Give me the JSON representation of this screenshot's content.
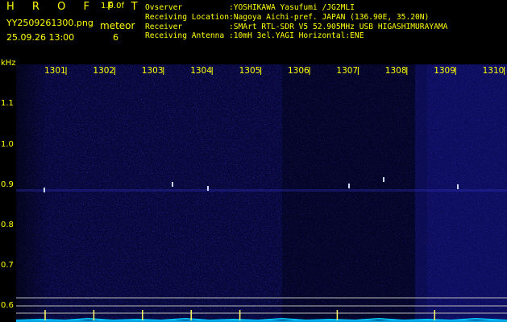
{
  "header": {
    "app_name": "H R O F F T",
    "version": "1.0.0f",
    "filename": "YY2509261300.png",
    "datetime": "25.09.26 13:00",
    "meteor_label": "meteor",
    "meteor_count": "6"
  },
  "info": {
    "observer_label": "Ovserver",
    "observer_value": ":YOSHIKAWA Yasufumi /JG2MLI",
    "location_label": "Receiving Location",
    "location_value": ":Nagoya Aichi-pref. JAPAN (136.90E, 35.20N)",
    "receiver_label": "Receiver",
    "receiver_value": ":SMArt RTL-SDR V5 52.905MHz USB HIGASHIMURAYAMA",
    "antenna_label": "Receiving Antenna",
    "antenna_value": ":10mH 3el.YAGI Horizontal:ENE"
  },
  "axis": {
    "y_unit": "kHz",
    "y_ticks": [
      "1.1",
      "1.0",
      "0.9",
      "0.8",
      "0.7",
      "0.6"
    ],
    "time_labels": [
      "1301",
      "1302",
      "1303",
      "1304",
      "1305",
      "1306",
      "1307",
      "1308",
      "1309",
      "1310"
    ]
  },
  "colors": {
    "text": "#ffff00",
    "background": "#000000",
    "spectrogram": "#0a0a5a",
    "baseline": "#00c8ff"
  }
}
